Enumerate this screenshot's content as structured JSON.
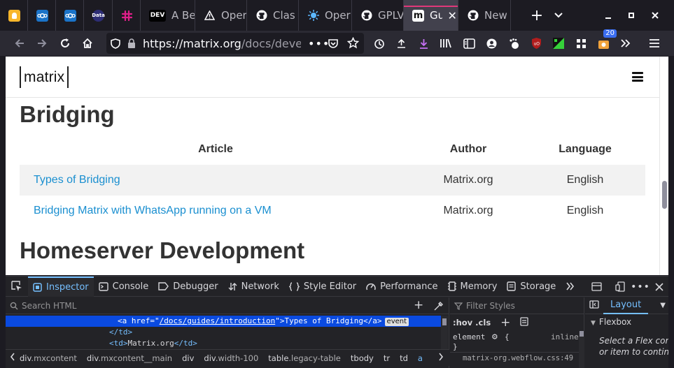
{
  "tabs": [
    {
      "title": "",
      "icon": "bulb-icon",
      "color": "#f5a623"
    },
    {
      "title": "",
      "icon": "nextcloud-icon",
      "color": "#1a73c8"
    },
    {
      "title": "",
      "icon": "nextcloud-icon",
      "color": "#1a73c8"
    },
    {
      "title": "",
      "icon": "data-icon",
      "color": "#2d2d75",
      "glyph": "Data"
    },
    {
      "title": "",
      "icon": "slack-icon",
      "color": "#4a154b"
    },
    {
      "title": "A Be",
      "icon": "dev-icon",
      "color": "#000000",
      "glyph": "DEV"
    },
    {
      "title": "Oper",
      "icon": "warning-icon",
      "color": "#1c1b22"
    },
    {
      "title": "Clas",
      "icon": "github-icon",
      "color": "#1c1b22"
    },
    {
      "title": "Oper",
      "icon": "openapi-icon",
      "color": "#1c1b22"
    },
    {
      "title": "GPLV",
      "icon": "github-icon",
      "color": "#1c1b22"
    },
    {
      "title": "Gu",
      "icon": "matrix-icon",
      "color": "#ffffff",
      "glyph": "m",
      "active": true
    },
    {
      "title": "New",
      "icon": "github-icon",
      "color": "#1c1b22"
    }
  ],
  "navbar": {
    "url_domain": "https://matrix.org",
    "url_rest": "/docs/deve",
    "extension_badge": "20"
  },
  "site": {
    "logo": "matrix"
  },
  "content": {
    "section1_title": "Bridging",
    "table_headers": [
      "Article",
      "Author",
      "Language"
    ],
    "rows": [
      {
        "article": "Types of Bridging",
        "author": "Matrix.org",
        "language": "English"
      },
      {
        "article": "Bridging Matrix with WhatsApp running on a VM",
        "author": "Matrix.org",
        "language": "English"
      }
    ],
    "section2_title": "Homeserver Development"
  },
  "devtools": {
    "tabs": [
      {
        "label": "Inspector",
        "icon": "inspector-icon",
        "active": true
      },
      {
        "label": "Console",
        "icon": "console-icon"
      },
      {
        "label": "Debugger",
        "icon": "debugger-icon"
      },
      {
        "label": "Network",
        "icon": "network-icon"
      },
      {
        "label": "Style Editor",
        "icon": "style-editor-icon"
      },
      {
        "label": "Performance",
        "icon": "performance-icon"
      },
      {
        "label": "Memory",
        "icon": "memory-icon"
      },
      {
        "label": "Storage",
        "icon": "storage-icon"
      }
    ],
    "search_placeholder": "Search HTML",
    "markup": {
      "selected": {
        "open": "<a ",
        "attr": "href",
        "eq": "=\"",
        "val": "/docs/guides/introduction",
        "close": "\">",
        "text": "Types of Bridging",
        "end": "</a>",
        "badge": "event"
      },
      "line2": "</td>",
      "line3_open": "<td>",
      "line3_text": "Matrix.org",
      "line3_close": "</td>"
    },
    "breadcrumbs": [
      {
        "tag": "div",
        "cls": ".mxcontent"
      },
      {
        "tag": "div",
        "cls": ".mxcontent__main"
      },
      {
        "tag": "div",
        "cls": ""
      },
      {
        "tag": "div",
        "cls": ".width-100"
      },
      {
        "tag": "table",
        "cls": ".legacy-table"
      },
      {
        "tag": "tbody",
        "cls": ""
      },
      {
        "tag": "tr",
        "cls": ""
      },
      {
        "tag": "td",
        "cls": ""
      },
      {
        "tag": "a",
        "cls": ""
      }
    ],
    "filter_placeholder": "Filter Styles",
    "hov_cls": ":hov .cls",
    "element_rule": "element",
    "element_brace": "{",
    "element_close": "}",
    "inline_label": "inline",
    "stylesheet_ref": "matrix-org.webflow.css:49",
    "layout_tab": "Layout",
    "flexbox_label": "Flexbox",
    "flex_hint_1": "Select a Flex con",
    "flex_hint_2": "or item to contin"
  }
}
